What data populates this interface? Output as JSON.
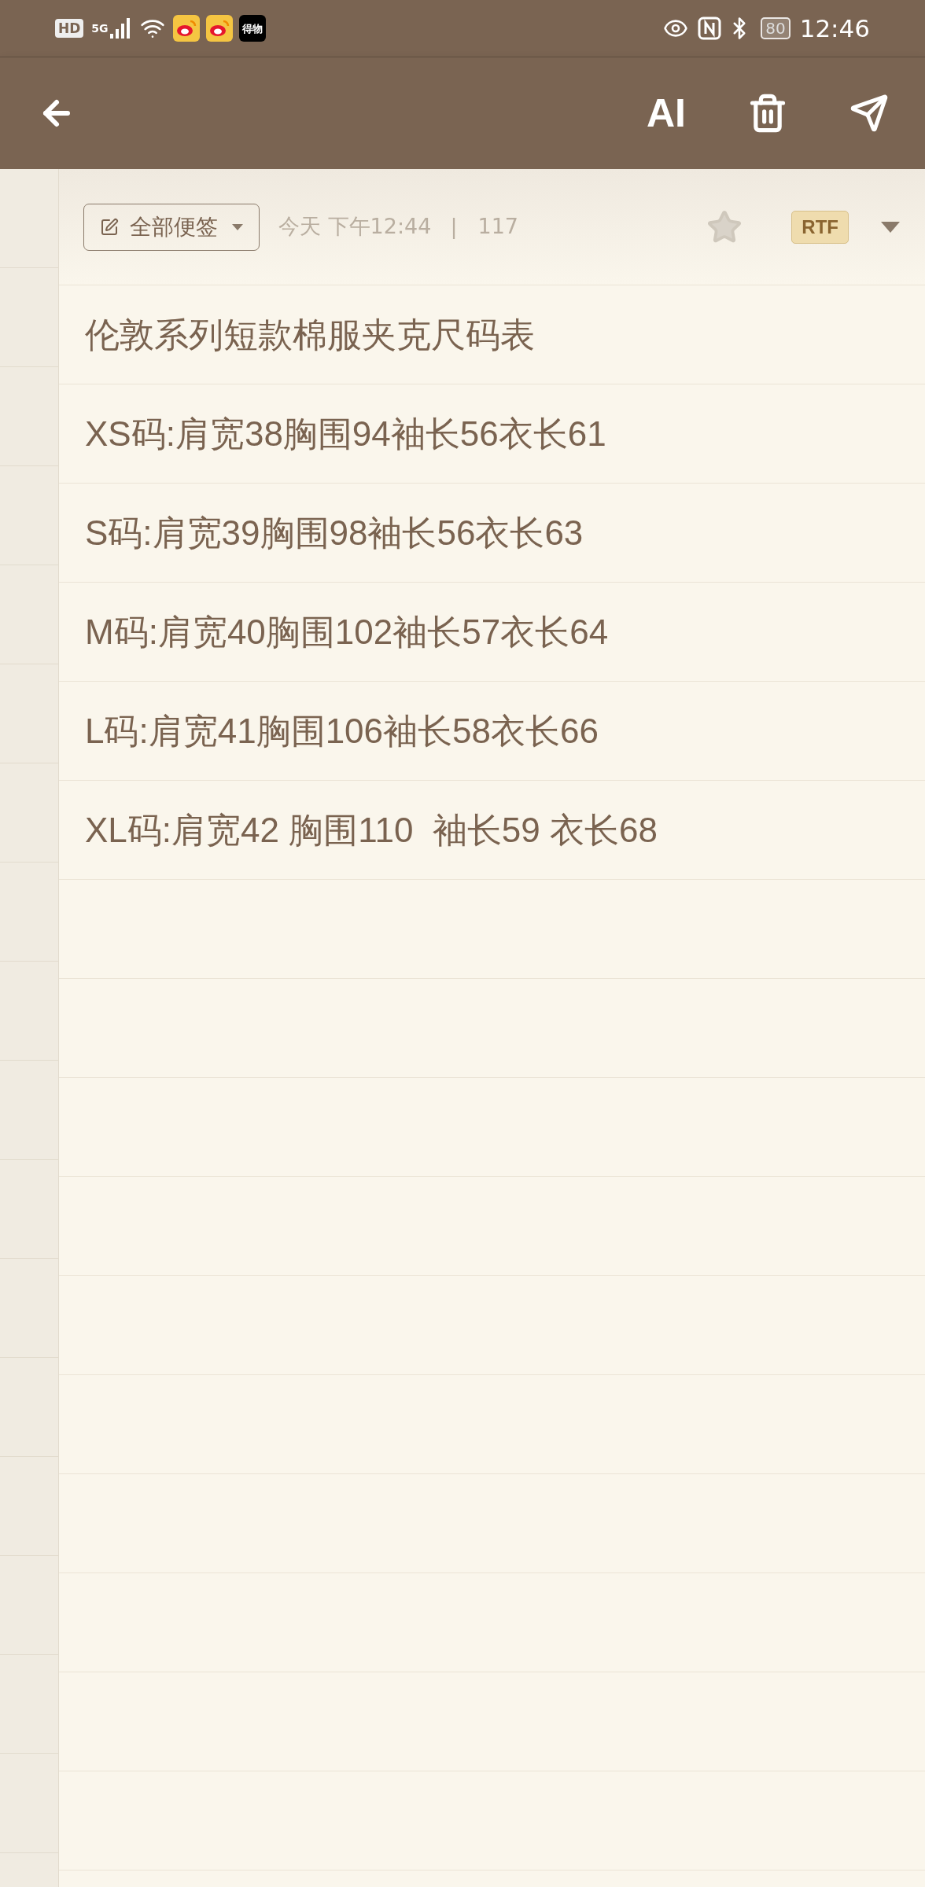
{
  "status_bar": {
    "hd": "HD",
    "network": "5G",
    "notifications": [
      {
        "kind": "weibo"
      },
      {
        "kind": "weibo"
      },
      {
        "kind": "app",
        "label": "得物"
      }
    ],
    "battery": "80",
    "time": "12:46"
  },
  "toolbar": {
    "ai": "AI"
  },
  "meta": {
    "folder": "全部便签",
    "date": "今天 下午12:44",
    "separator": "|",
    "count": "117",
    "starred": false,
    "format": "RTF"
  },
  "lines": [
    "伦敦系列短款棉服夹克尺码表",
    "XS码:肩宽38胸围94袖长56衣长61",
    "S码:肩宽39胸围98袖长56衣长63",
    "M码:肩宽40胸围102袖长57衣长64",
    "L码:肩宽41胸围106袖长58衣长66",
    "XL码:肩宽42 胸围110  袖长59 衣长68"
  ]
}
